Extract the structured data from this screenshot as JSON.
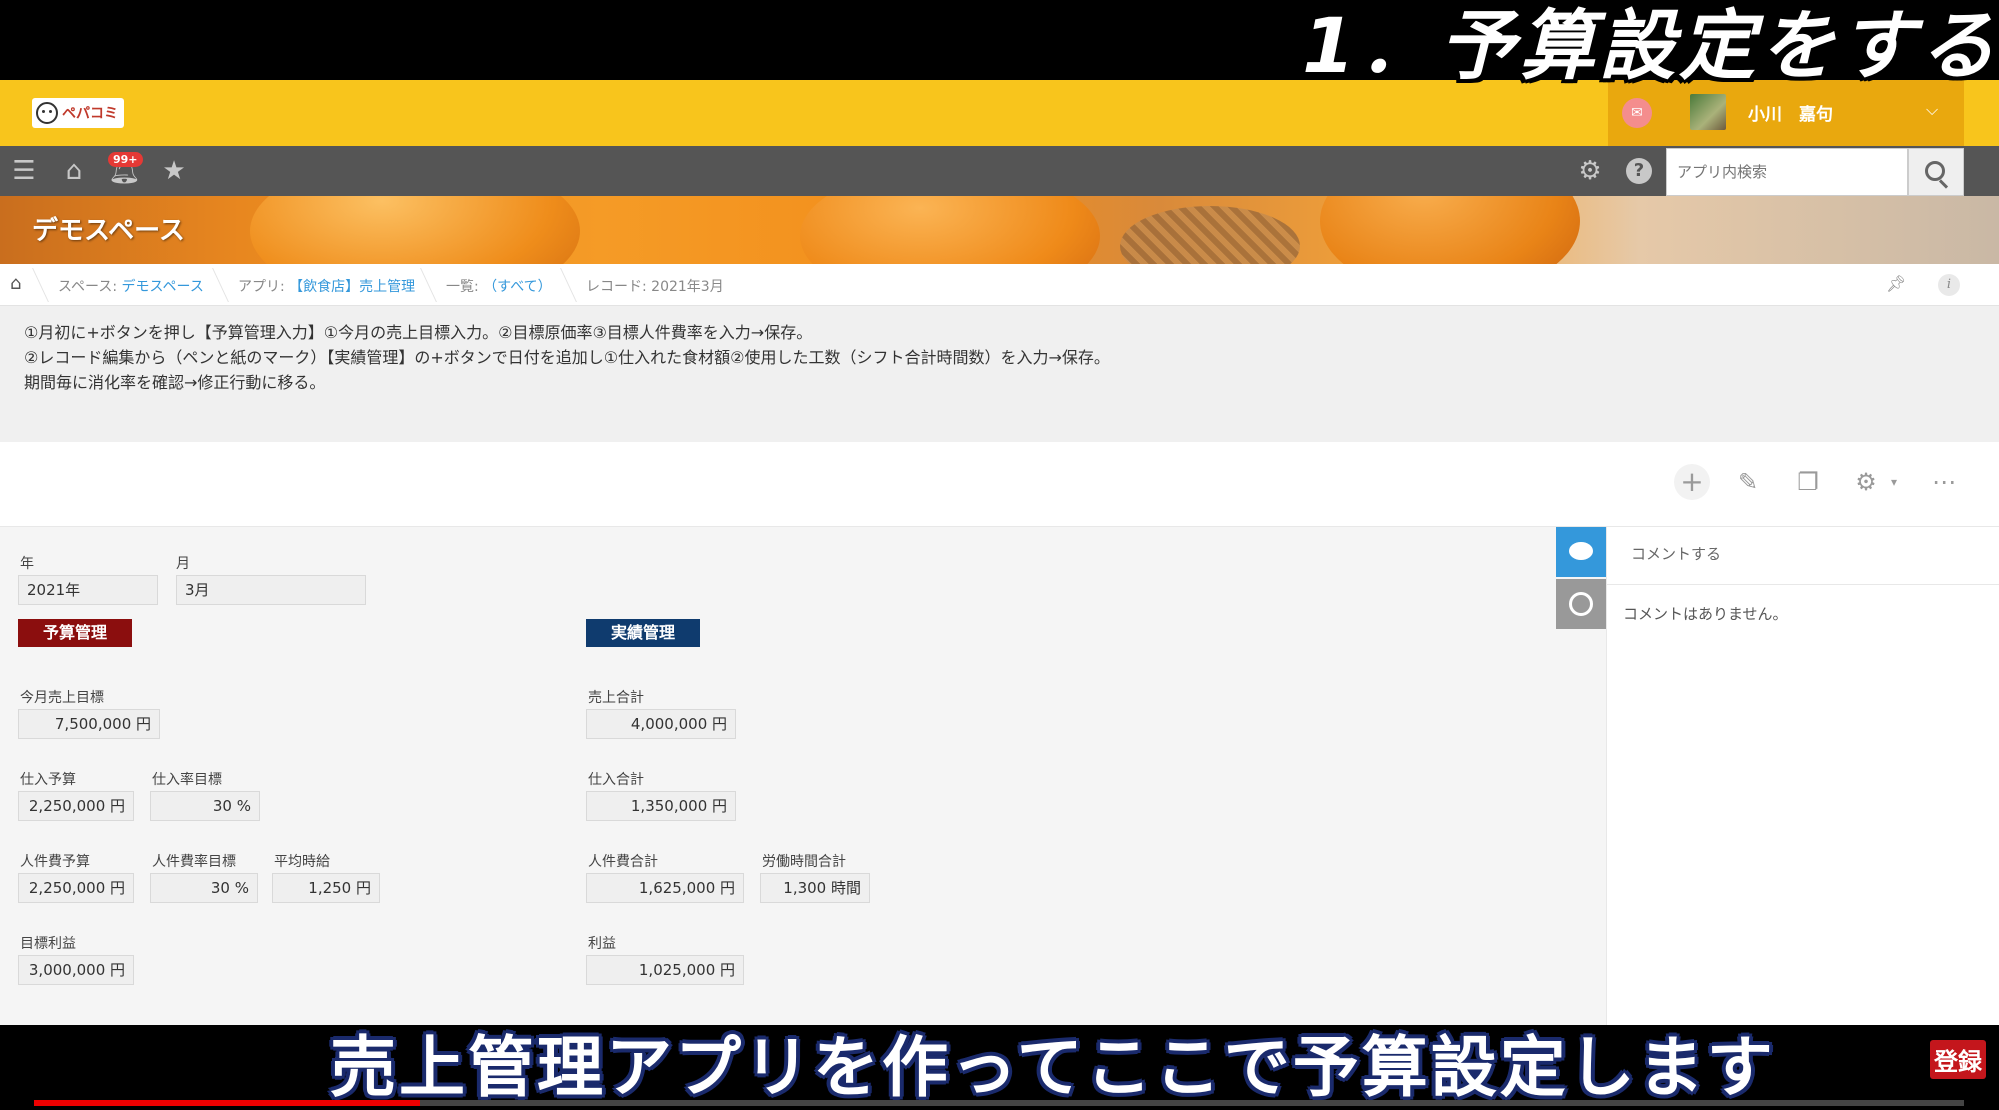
{
  "video": {
    "overlay_title": "1．予算設定をする",
    "subtitle": "売上管理アプリを作ってここで予算設定します",
    "subscribe_label": "登録",
    "progress": 0.2
  },
  "header": {
    "logo_text": "ペパコミ",
    "user_name": "小川　嘉句"
  },
  "nav": {
    "notification_badge": "99+",
    "search_placeholder": "アプリ内検索"
  },
  "banner": {
    "space_title": "デモスペース"
  },
  "breadcrumb": {
    "space_prefix": "スペース: ",
    "space_name": "デモスペース",
    "app_prefix": "アプリ: ",
    "app_name": "【飲食店】売上管理",
    "list_prefix": "一覧: ",
    "list_name": "（すべて）",
    "record": "レコード: 2021年3月"
  },
  "description": {
    "line1": "①月初に+ボタンを押し【予算管理入力】①今月の売上目標入力。②目標原価率③目標人件費率を入力→保存。",
    "line2": "②レコード編集から（ペンと紙のマーク）【実績管理】の+ボタンで日付を追加し①仕入れた食材額②使用した工数（シフト合計時間数）を入力→保存。",
    "line3": "期間毎に消化率を確認→修正行動に移る。"
  },
  "record": {
    "year_label": "年",
    "year_value": "2021年",
    "month_label": "月",
    "month_value": "3月",
    "budget_section": "予算管理",
    "actual_section": "実績管理",
    "budget": {
      "sales_target_label": "今月売上目標",
      "sales_target": "7,500,000 円",
      "purchase_budget_label": "仕入予算",
      "purchase_budget": "2,250,000 円",
      "purchase_rate_label": "仕入率目標",
      "purchase_rate": "30 %",
      "labor_budget_label": "人件費予算",
      "labor_budget": "2,250,000 円",
      "labor_rate_label": "人件費率目標",
      "labor_rate": "30 %",
      "hourly_wage_label": "平均時給",
      "hourly_wage": "1,250 円",
      "profit_target_label": "目標利益",
      "profit_target": "3,000,000 円"
    },
    "actual": {
      "sales_total_label": "売上合計",
      "sales_total": "4,000,000 円",
      "purchase_total_label": "仕入合計",
      "purchase_total": "1,350,000 円",
      "labor_total_label": "人件費合計",
      "labor_total": "1,625,000 円",
      "work_hours_label": "労働時間合計",
      "work_hours": "1,300 時間",
      "profit_label": "利益",
      "profit": "1,025,000 円"
    }
  },
  "sidebar": {
    "comment_placeholder": "コメントする",
    "no_comments": "コメントはありません。"
  },
  "colors": {
    "header": "#f8c51c",
    "nav": "#555555",
    "budget_tag": "#8b0e0e",
    "actual_tag": "#0f3b6e",
    "accent": "#3498db"
  }
}
